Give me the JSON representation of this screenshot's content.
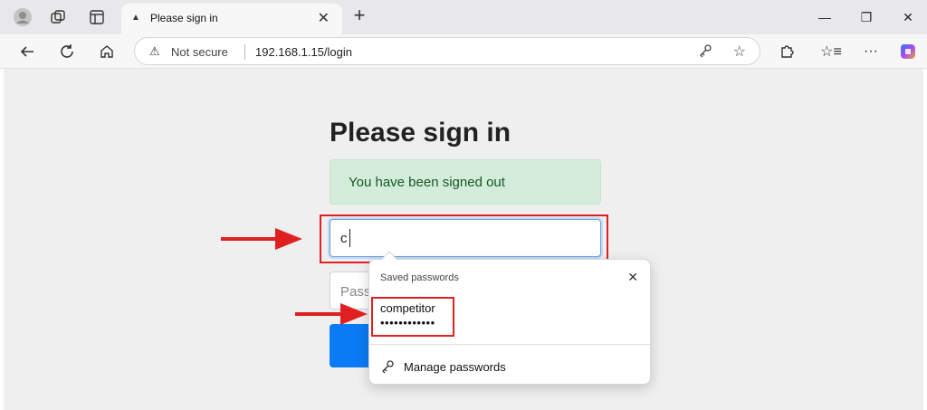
{
  "browser": {
    "tab": {
      "title": "Please sign in",
      "favicon": "warning-triangle-icon"
    },
    "address_bar": {
      "security_label": "Not secure",
      "url": "192.168.1.15/login"
    },
    "icons": [
      "profile-icon",
      "workspaces-icon",
      "tab-actions-icon",
      "back-icon",
      "refresh-icon",
      "home-icon",
      "key-icon",
      "favorite-star-icon",
      "extensions-icon",
      "favorites-icon",
      "more-icon",
      "copilot-icon",
      "minimize-icon",
      "restore-icon",
      "close-window-icon"
    ],
    "accent_color": "#0a7bf5"
  },
  "page": {
    "heading": "Please sign in",
    "alert": {
      "text": "You have been signed out",
      "color": "#155724",
      "background": "#d4edda"
    },
    "username": {
      "value": "c"
    },
    "password": {
      "placeholder": "Pass"
    }
  },
  "autofill_popup": {
    "title": "Saved passwords",
    "entry": {
      "username": "competitor",
      "password_mask": "••••••••••••"
    },
    "manage_label": "Manage passwords"
  },
  "annotations": {
    "color": "#e02020"
  }
}
